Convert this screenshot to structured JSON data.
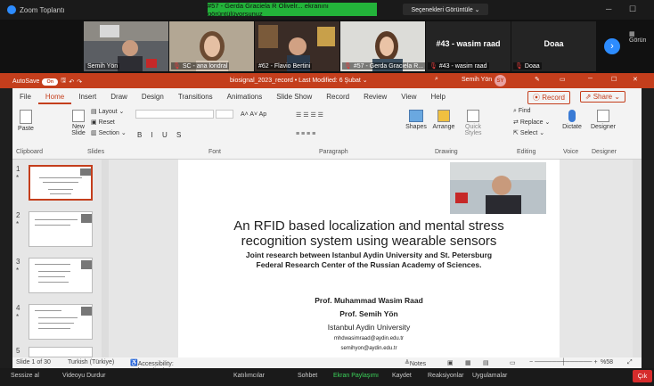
{
  "zoom": {
    "app_title": "Zoom Toplantı",
    "share_banner": "#57 - Gerda Graciela R Olivelr... ekranını görüntülüyorsunuz",
    "view_options": "Seçenekleri Görüntüle ⌄",
    "gallery_label": "Görün"
  },
  "participants": [
    {
      "name": "Semih Yön",
      "has_video": true
    },
    {
      "name": "SC - ana londral",
      "has_video": true
    },
    {
      "name": "#62 - Flavio Bertini",
      "has_video": true
    },
    {
      "name": "#57 - Gerda Graciela R...",
      "has_video": true
    },
    {
      "name": "#43 - wasim raad",
      "big_name": "#43 - wasim raad",
      "has_video": false
    },
    {
      "name": "Doaa",
      "big_name": "Doaa",
      "has_video": false
    }
  ],
  "ppt": {
    "autosave_label": "AutoSave",
    "autosave_state": "On",
    "doc_title": "biosignal_2023_record • Last Modified: 6 Şubat ⌄",
    "user_name": "Semih Yön",
    "user_initials": "SY",
    "menu": [
      "File",
      "Home",
      "Insert",
      "Draw",
      "Design",
      "Transitions",
      "Animations",
      "Slide Show",
      "Record",
      "Review",
      "View",
      "Help"
    ],
    "active_menu": "Home",
    "record_label": "⦿ Record",
    "share_label": "⇗ Share ⌄",
    "tools": {
      "paste": "Paste",
      "new_slide": "New Slide",
      "layout": "Layout ⌄",
      "reset": "Reset",
      "section": "Section ⌄",
      "shapes": "Shapes",
      "arrange": "Arrange",
      "quick_styles": "Quick Styles",
      "find": "Find",
      "replace": "Replace ⌄",
      "select": "Select ⌄",
      "dictate": "Dictate",
      "designer": "Designer"
    },
    "groups": [
      "Clipboard",
      "Slides",
      "Font",
      "Paragraph",
      "Drawing",
      "Editing",
      "Voice",
      "Designer"
    ],
    "slide": {
      "title_line1": "An RFID based localization and mental stress",
      "title_line2": "recognition system using wearable sensors",
      "sub_line1": "Joint  research  between Istanbul Aydin University and St. Petersburg",
      "sub_line2": "Federal Research Center of the Russian Academy of Sciences.",
      "prof1": "Prof. Muhammad Wasim Raad",
      "prof2": "Prof. Semih Yön",
      "university": "Istanbul Aydin University",
      "email1": "mhdwasimraad@aydin.edu.tr",
      "email2": "semihyon@aydin.edu.tr"
    },
    "thumb_numbers": [
      "1",
      "2",
      "3",
      "4",
      "5"
    ],
    "status": {
      "slide_count": "Slide 1 of 30",
      "language": "Turkish (Türkiye)",
      "accessibility": "Accessibility: Investigate",
      "notes": "Notes",
      "zoom": "%58"
    }
  },
  "zoom_bottom": {
    "mute": "Sessize al",
    "video": "Videoyu Durdur",
    "participants": "Katılımcılar",
    "chat": "Sohbet",
    "share": "Ekran Paylaşımı",
    "record": "Kaydet",
    "reactions": "Reaksiyonlar",
    "apps": "Uygulamalar",
    "end": "Çık"
  },
  "colors": {
    "ppt_accent": "#c43e1c",
    "zoom_blue": "#2d8cff",
    "share_green": "#23b33a"
  }
}
